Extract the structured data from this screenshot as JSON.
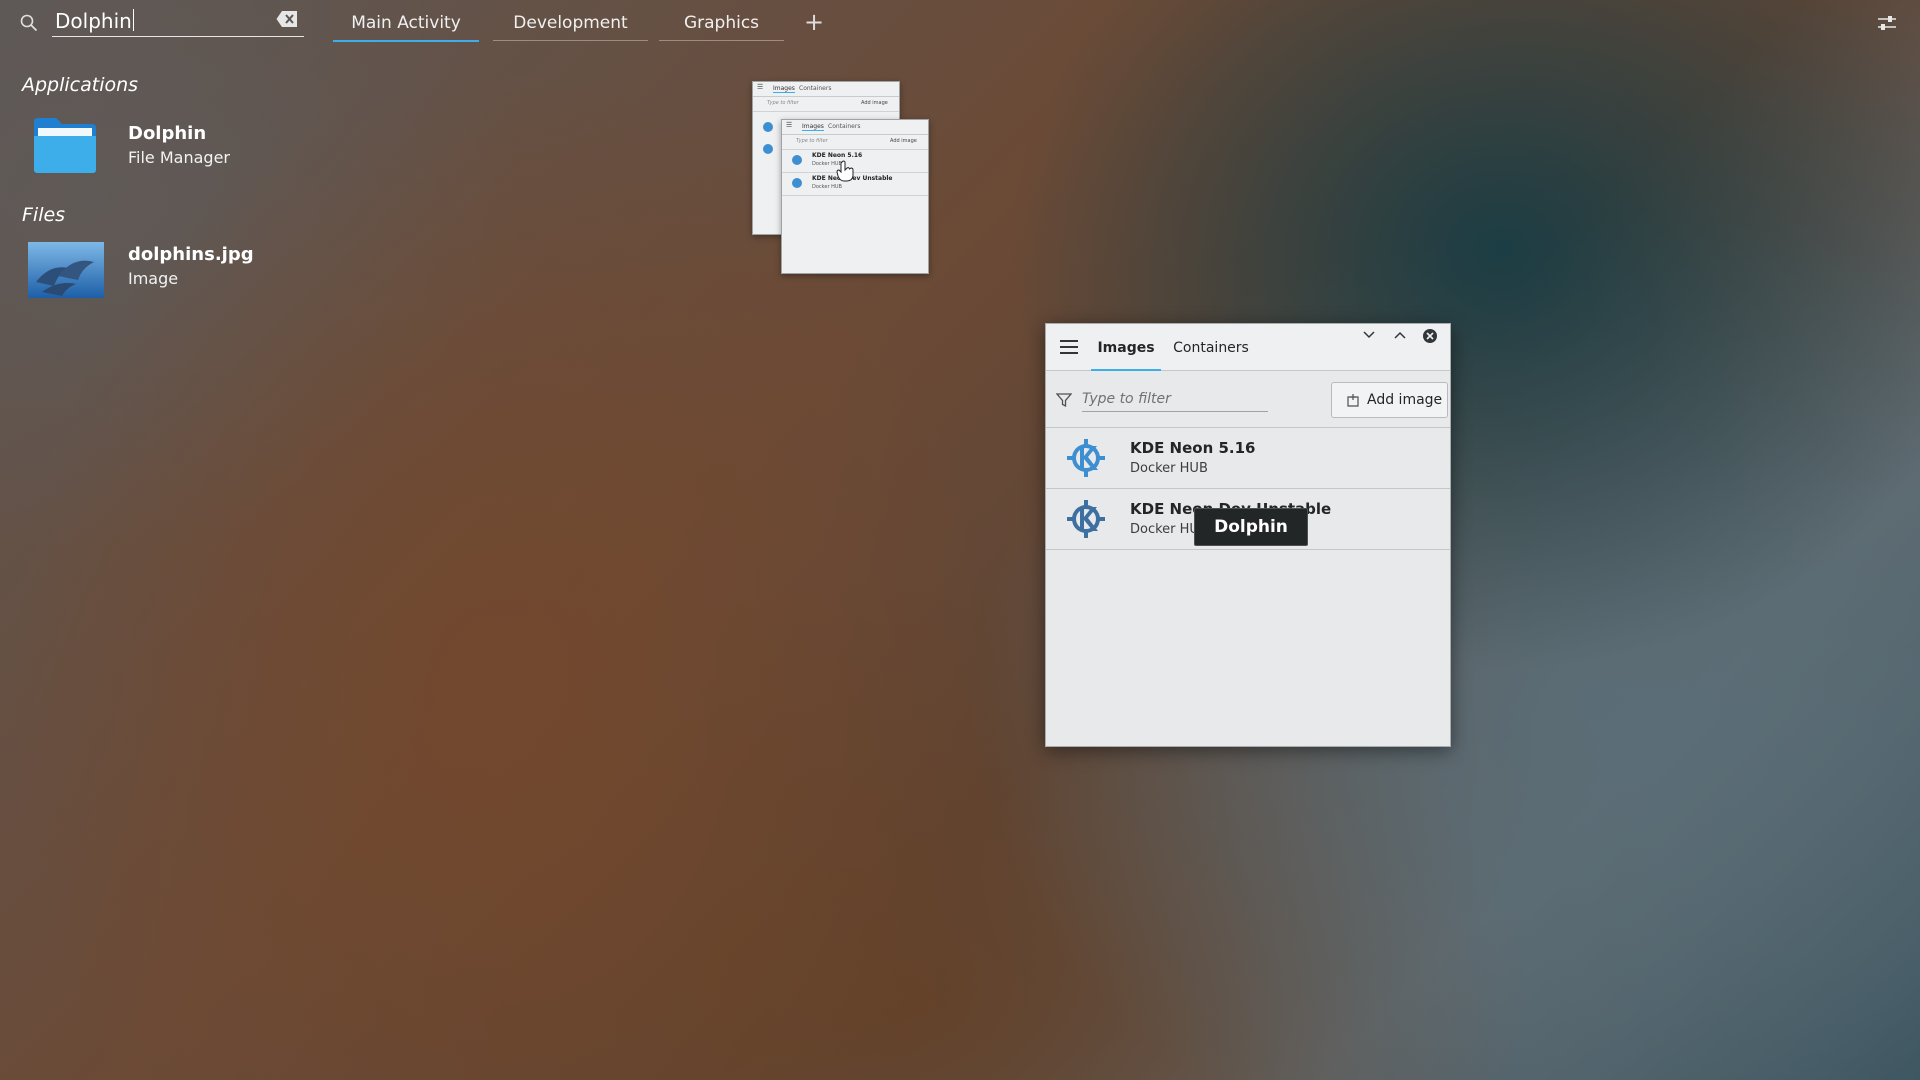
{
  "search": {
    "query": "Dolphin"
  },
  "activities": {
    "tabs": [
      {
        "label": "Main Activity",
        "active": true
      },
      {
        "label": "Development",
        "active": false
      },
      {
        "label": "Graphics",
        "active": false
      }
    ],
    "add_label": "+"
  },
  "results": {
    "applications": {
      "heading": "Applications",
      "items": [
        {
          "title": "Dolphin",
          "subtitle": "File Manager",
          "icon": "folder-icon"
        }
      ]
    },
    "files": {
      "heading": "Files",
      "items": [
        {
          "title": "dolphins.jpg",
          "subtitle": "Image",
          "icon": "image-thumbnail"
        }
      ]
    }
  },
  "thumbnails": {
    "back": {
      "tabs": [
        "Images",
        "Containers"
      ],
      "filter_placeholder": "Type to filter",
      "add_label": "Add image",
      "items": []
    },
    "front": {
      "tabs": [
        "Images",
        "Containers"
      ],
      "filter_placeholder": "Type to filter",
      "add_label": "Add image",
      "items": [
        {
          "title": "KDE Neon 5.16",
          "subtitle": "Docker HUB"
        },
        {
          "title": "KDE Neon Dev Unstable",
          "subtitle": "Docker HUB"
        }
      ]
    }
  },
  "window": {
    "tabs": [
      {
        "label": "Images",
        "active": true
      },
      {
        "label": "Containers",
        "active": false
      }
    ],
    "filter_placeholder": "Type to filter",
    "add_image_label": "Add image",
    "items": [
      {
        "title": "KDE Neon 5.16",
        "subtitle": "Docker HUB"
      },
      {
        "title": "KDE Neon Dev Unstable",
        "subtitle": "Docker HUB"
      }
    ]
  },
  "tooltip": {
    "text": "Dolphin"
  },
  "colors": {
    "accent": "#3daee9",
    "kde_blue": "#1d99f3"
  }
}
